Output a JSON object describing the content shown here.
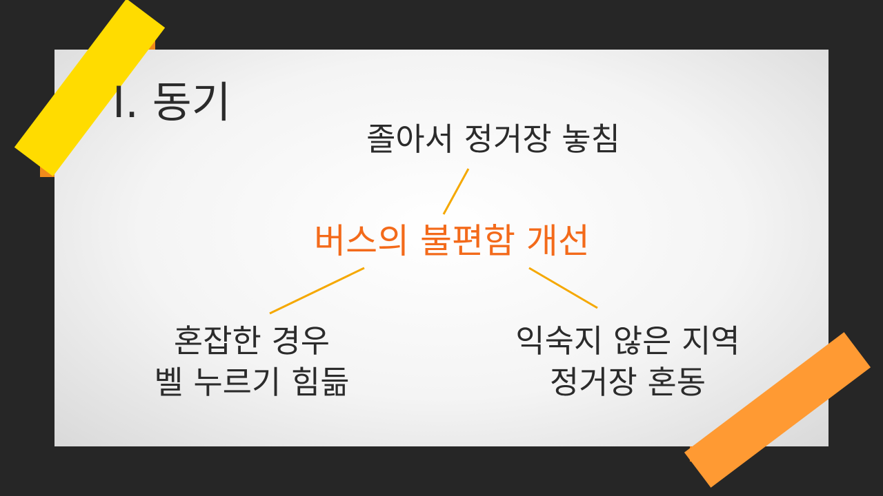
{
  "slide": {
    "title": "I. 동기",
    "center": "버스의 불편함 개선",
    "top": "졸아서 정거장 놓침",
    "left": [
      "혼잡한 경우",
      "벨 누르기 힘듦"
    ],
    "right": [
      "익숙지 않은 지역",
      "정거장 혼동"
    ]
  },
  "colors": {
    "accent": "#f36a1a",
    "connector": "#f5a800",
    "tape_yellow": "#ffdc00",
    "tape_orange": "#ff9a33",
    "background": "#262626"
  }
}
